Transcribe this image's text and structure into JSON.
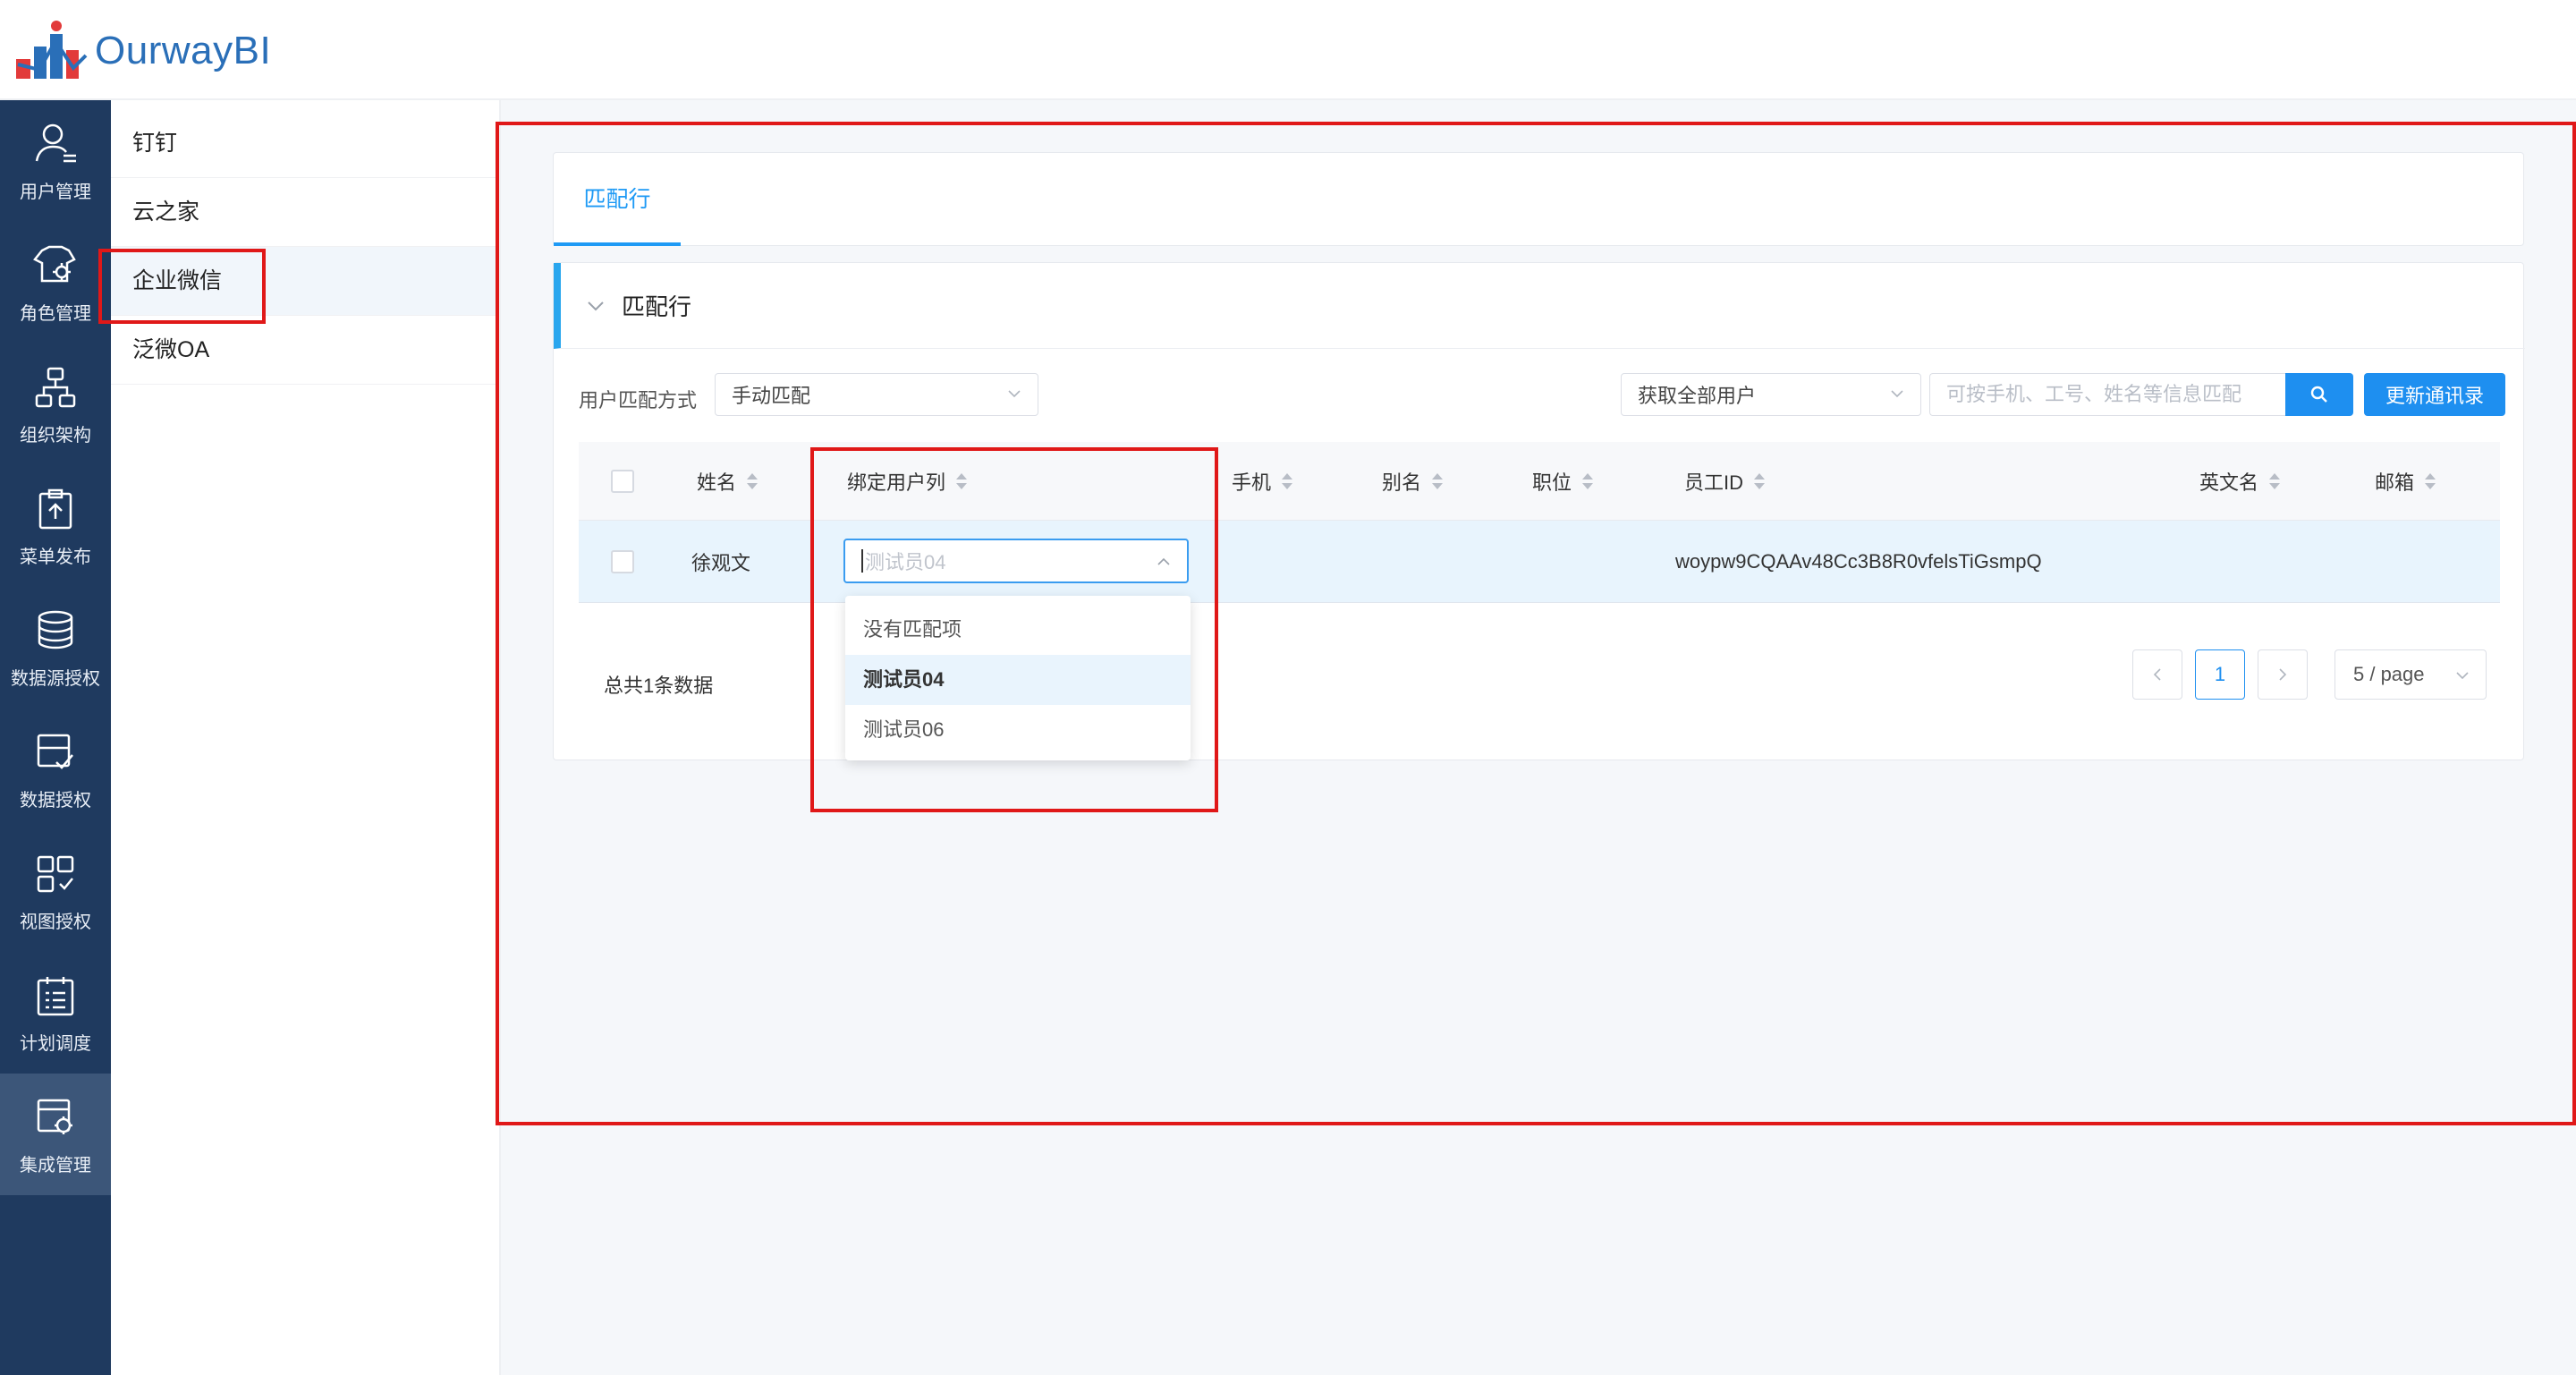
{
  "app": {
    "logo_text": "OurwayBI"
  },
  "nav": {
    "items": [
      {
        "label": "用户管理",
        "icon": "user-icon"
      },
      {
        "label": "角色管理",
        "icon": "role-settings-icon"
      },
      {
        "label": "组织架构",
        "icon": "org-chart-icon"
      },
      {
        "label": "菜单发布",
        "icon": "publish-icon"
      },
      {
        "label": "数据源授权",
        "icon": "database-icon"
      },
      {
        "label": "数据授权",
        "icon": "data-auth-icon"
      },
      {
        "label": "视图授权",
        "icon": "view-grid-icon"
      },
      {
        "label": "计划调度",
        "icon": "schedule-icon"
      },
      {
        "label": "集成管理",
        "icon": "integration-icon",
        "active": true
      }
    ]
  },
  "subnav": {
    "items": [
      {
        "label": "钉钉"
      },
      {
        "label": "云之家"
      },
      {
        "label": "企业微信",
        "active": true
      },
      {
        "label": "泛微OA"
      }
    ]
  },
  "tabs": [
    {
      "label": "匹配行",
      "active": true
    }
  ],
  "panel": {
    "title": "匹配行",
    "match_mode_label": "用户匹配方式",
    "match_mode_value": "手动匹配",
    "user_scope_value": "获取全部用户",
    "search_placeholder": "可按手机、工号、姓名等信息匹配",
    "update_button": "更新通讯录"
  },
  "table": {
    "columns": [
      "姓名",
      "绑定用户列",
      "手机",
      "别名",
      "职位",
      "员工ID",
      "英文名",
      "邮箱"
    ],
    "rows": [
      {
        "name": "徐观文",
        "bound_user_placeholder": "测试员04",
        "phone": "",
        "alias": "",
        "position": "",
        "employee_id": "woypw9CQAAv48Cc3B8R0vfelsTiGsmpQ",
        "english_name": "",
        "email": ""
      }
    ]
  },
  "dropdown": {
    "options": [
      {
        "label": "没有匹配项"
      },
      {
        "label": "测试员04",
        "selected": true
      },
      {
        "label": "测试员06"
      }
    ]
  },
  "pagination": {
    "total_text": "总共1条数据",
    "current_page": "1",
    "page_size": "5 / page"
  },
  "colors": {
    "accent": "#1e8ff0",
    "nav_bg": "#1f3a5f",
    "annotation": "#e01818"
  }
}
